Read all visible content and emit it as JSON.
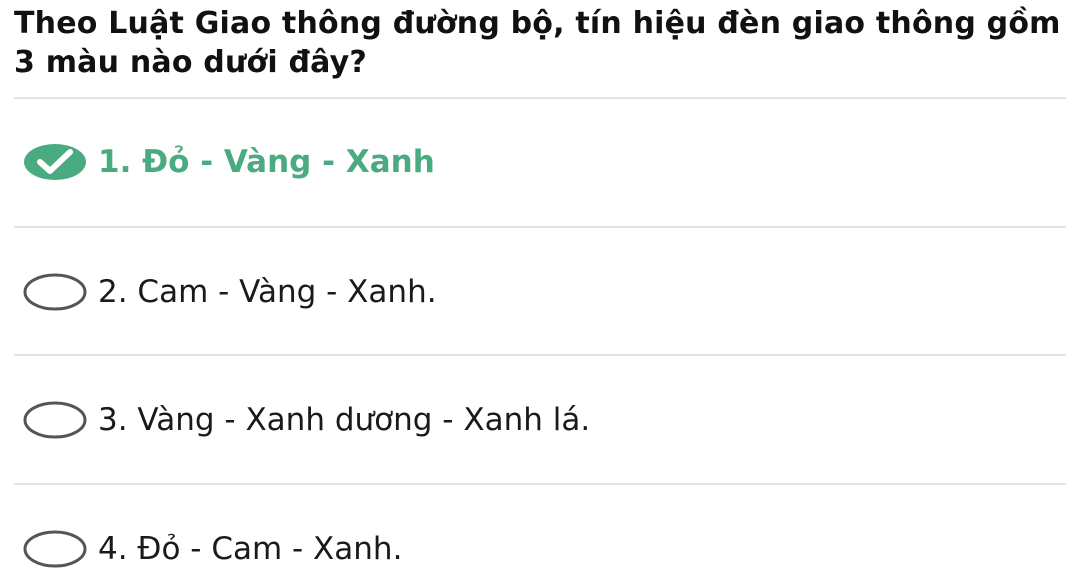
{
  "question": {
    "text": "Theo Luật Giao thông đường bộ, tín hiệu đèn giao thông gồm 3 màu nào dưới đây?"
  },
  "colors": {
    "correct": "#4aaa80",
    "radio_border": "#555555",
    "divider": "#e2e2e2"
  },
  "options": [
    {
      "number": "1.",
      "label": "Đỏ - Vàng - Xanh",
      "selected": true,
      "correct": true
    },
    {
      "number": "2.",
      "label": "Cam - Vàng - Xanh.",
      "selected": false,
      "correct": false
    },
    {
      "number": "3.",
      "label": "Vàng - Xanh dương - Xanh lá.",
      "selected": false,
      "correct": false
    },
    {
      "number": "4.",
      "label": "Đỏ - Cam - Xanh.",
      "selected": false,
      "correct": false
    }
  ],
  "icons": {
    "correct": "check-icon",
    "unselected": "radio-empty-icon"
  }
}
